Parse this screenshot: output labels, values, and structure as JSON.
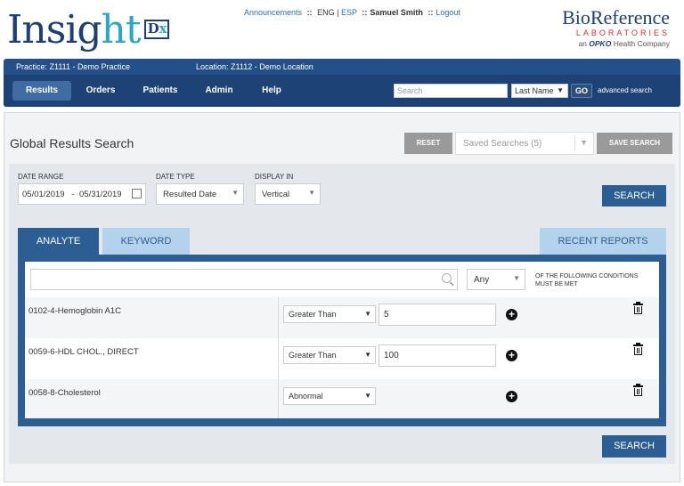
{
  "header": {
    "logo_main": "Insig",
    "logo_accent": "ht",
    "logo_badge_d": "D",
    "logo_badge_x": "x",
    "links": {
      "announcements": "Announcements",
      "sep1": "::",
      "eng": "ENG",
      "bar": "|",
      "esp": "ESP",
      "sep2": "::",
      "user": "Samuel Smith",
      "sep3": "::",
      "logout": "Logout"
    },
    "brand": {
      "name": "BioReference",
      "sub": "LABORATORIES",
      "tagline_pre": "an",
      "tagline_opko": "OPKO",
      "tagline_post": "Health Company"
    }
  },
  "nav": {
    "practice": "Practice:  Z1111 - Demo Practice",
    "location": "Location:  Z1112 - Demo Location",
    "items": [
      "Results",
      "Orders",
      "Patients",
      "Admin",
      "Help"
    ],
    "search_placeholder": "Search",
    "search_by": "Last Name",
    "go": "GO",
    "advanced": "advanced search"
  },
  "page": {
    "title": "Global Results Search",
    "reset": "RESET",
    "saved_searches": "Saved Searches (5)",
    "save_search": "SAVE SEARCH"
  },
  "filters": {
    "date_range_label": "DATE RANGE",
    "date_from": "05/01/2019",
    "date_dash": "-",
    "date_to": "05/31/2019",
    "date_type_label": "DATE TYPE",
    "date_type": "Resulted Date",
    "display_in_label": "DISPLAY IN",
    "display_in": "Vertical",
    "search": "SEARCH"
  },
  "tabs": {
    "analyte": "ANALYTE",
    "keyword": "KEYWORD",
    "recent": "RECENT REPORTS"
  },
  "criteria": {
    "match": "Any",
    "conditions_text": "OF THE FOLLOWING CONDITIONS MUST BE MET",
    "rows": [
      {
        "analyte": "0102-4-Hemoglobin A1C",
        "operator": "Greater Than",
        "value": "5"
      },
      {
        "analyte": "0059-6-HDL CHOL., DIRECT",
        "operator": "Greater Than",
        "value": "100"
      },
      {
        "analyte": "0058-8-Cholesterol",
        "operator": "Abnormal",
        "value": ""
      }
    ]
  },
  "footer": {
    "search": "SEARCH"
  },
  "colors": {
    "navy": "#1d4376",
    "accent_blue": "#2d5e93",
    "light_tab": "#b3d3ec",
    "teal": "#2aa6c9",
    "red": "#d0302f"
  }
}
